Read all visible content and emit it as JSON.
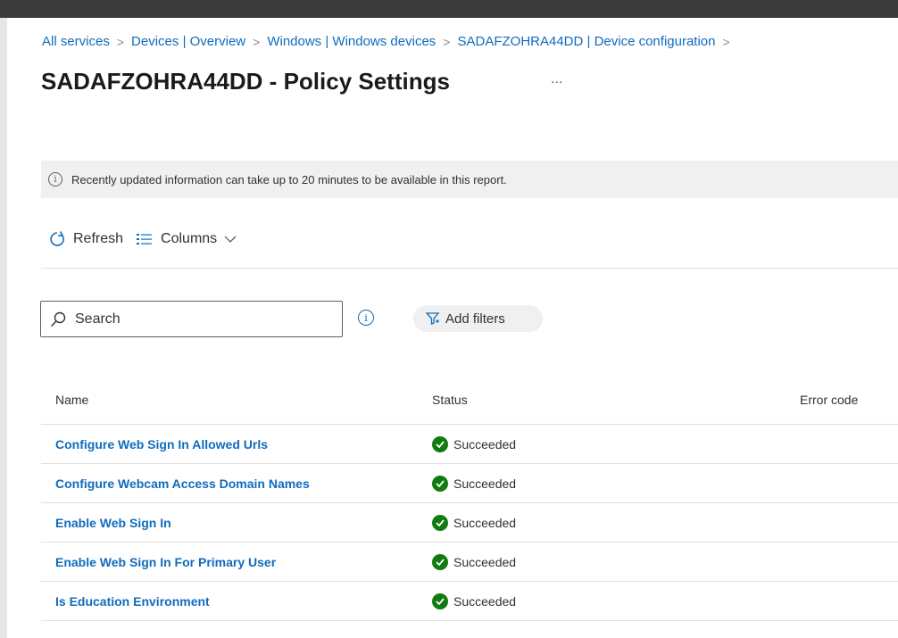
{
  "breadcrumb": [
    {
      "label": "All services"
    },
    {
      "label": "Devices | Overview"
    },
    {
      "label": "Windows | Windows devices"
    },
    {
      "label": "SADAFZOHRA44DD | Device configuration"
    }
  ],
  "page": {
    "title": "SADAFZOHRA44DD - Policy Settings",
    "more": "..."
  },
  "info_banner": {
    "icon": "info-icon",
    "text": "Recently updated information can take up to 20 minutes to be available in this report."
  },
  "toolbar": {
    "refresh_label": "Refresh",
    "columns_label": "Columns"
  },
  "search": {
    "placeholder": "Search",
    "value": ""
  },
  "filters": {
    "add_label": "Add filters"
  },
  "table": {
    "columns": [
      "Name",
      "Status",
      "Error code"
    ],
    "rows": [
      {
        "name": "Configure Web Sign In Allowed Urls",
        "status": "Succeeded",
        "error_code": ""
      },
      {
        "name": "Configure Webcam Access Domain Names",
        "status": "Succeeded",
        "error_code": ""
      },
      {
        "name": "Enable Web Sign In",
        "status": "Succeeded",
        "error_code": ""
      },
      {
        "name": "Enable Web Sign In For Primary User",
        "status": "Succeeded",
        "error_code": ""
      },
      {
        "name": "Is Education Environment",
        "status": "Succeeded",
        "error_code": ""
      }
    ]
  },
  "colors": {
    "link": "#0f6cbd",
    "success": "#107c10",
    "banner_bg": "#f0f0f0",
    "topbar": "#3b3b3b"
  }
}
